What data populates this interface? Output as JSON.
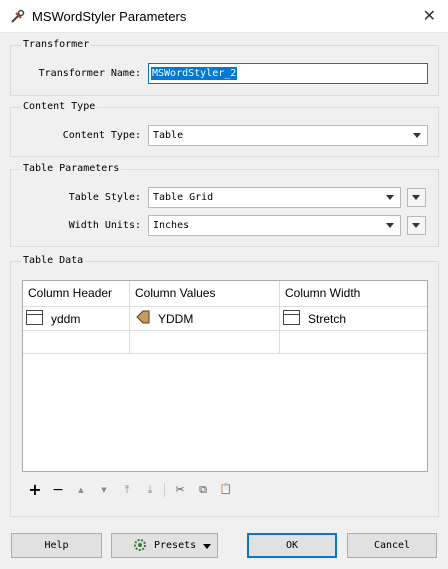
{
  "window": {
    "title": "MSWordStyler Parameters",
    "close_glyph": "✕"
  },
  "groups": {
    "transformer": {
      "title": "Transformer",
      "name_label": "Transformer Name:",
      "name_value": "MSWordStyler_2"
    },
    "content_type": {
      "title": "Content Type",
      "label": "Content Type:",
      "value": "Table"
    },
    "table_params": {
      "title": "Table Parameters",
      "style_label": "Table Style:",
      "style_value": "Table Grid",
      "width_label": "Width Units:",
      "width_value": "Inches"
    },
    "table_data": {
      "title": "Table Data",
      "columns": [
        "Column Header",
        "Column Values",
        "Column Width"
      ],
      "rows": [
        {
          "header": "yddm",
          "values": "YDDM",
          "width": "Stretch"
        }
      ]
    }
  },
  "toolbar": {
    "add": "+",
    "remove": "−",
    "move_up": "▲",
    "move_down": "▼",
    "move_top": "⤒",
    "move_bottom": "⤓",
    "cut": "✂",
    "copy": "⧉",
    "paste": "📋"
  },
  "buttons": {
    "help": "Help",
    "presets": "Presets",
    "ok": "OK",
    "cancel": "Cancel"
  }
}
